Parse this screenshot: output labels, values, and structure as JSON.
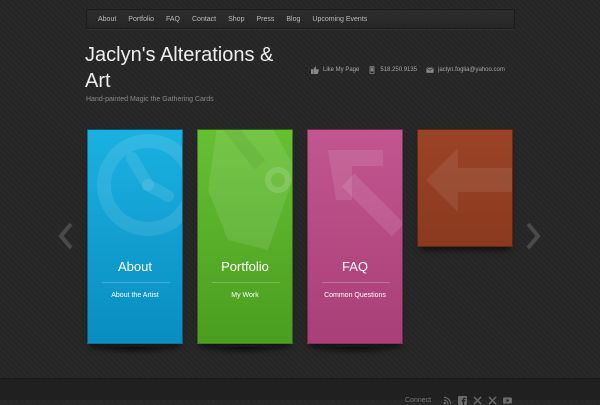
{
  "nav": {
    "items": [
      "About",
      "Portfolio",
      "FAQ",
      "Contact",
      "Shop",
      "Press",
      "Blog",
      "Upcoming Events"
    ]
  },
  "header": {
    "title": "Jaclyn's Alterations & Art",
    "tagline": "Hand-painted Magic the Gathering Cards",
    "contact": {
      "like": "Like My Page",
      "phone": "518.250.9135",
      "email": "jaclyn.foglia@yahoo.com"
    }
  },
  "slider": {
    "cards": [
      {
        "title": "About",
        "subtitle": "About the Artist",
        "color": "#1aa7d8",
        "icon": "clock-icon"
      },
      {
        "title": "Portfolio",
        "subtitle": "My Work",
        "color": "#5fb52c",
        "icon": "tag-icon"
      },
      {
        "title": "FAQ",
        "subtitle": "Common Questions",
        "color": "#b84b85",
        "icon": "arrow-up-left-icon"
      },
      {
        "title": "",
        "subtitle": "",
        "color": "#93401f",
        "icon": "arrow-left-icon"
      }
    ],
    "prev_icon": "chevron-left-icon",
    "next_icon": "chevron-right-icon"
  },
  "footer": {
    "label": "Connect",
    "icons": [
      "rss-icon",
      "facebook-icon",
      "twitter-icon",
      "twitter-icon",
      "youtube-icon"
    ]
  }
}
